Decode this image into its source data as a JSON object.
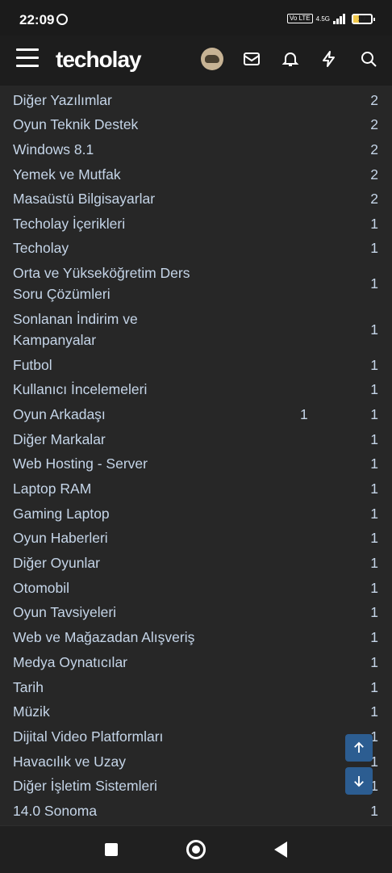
{
  "status": {
    "time": "22:09",
    "volte": "Vo LTE",
    "network": "4.5G",
    "battery": "17"
  },
  "header": {
    "logo": "techolay",
    "menu_icon": "hamburger-menu-icon",
    "avatar_icon": "avatar",
    "icons": [
      "mail-icon",
      "bell-icon",
      "lightning-icon",
      "search-icon"
    ]
  },
  "rows": [
    {
      "name": "Diğer Yazılımlar",
      "count": "2"
    },
    {
      "name": "Oyun Teknik Destek",
      "count": "2"
    },
    {
      "name": "Windows 8.1",
      "count": "2"
    },
    {
      "name": "Yemek ve Mutfak",
      "count": "2"
    },
    {
      "name": "Masaüstü Bilgisayarlar",
      "count": "2"
    },
    {
      "name": "Techolay İçerikleri",
      "count": "1"
    },
    {
      "name": "Techolay",
      "count": "1"
    },
    {
      "name": "Orta ve Yükseköğretim Ders",
      "name2": "Soru Çözümleri",
      "count": "1"
    },
    {
      "name": "Sonlanan İndirim ve",
      "name2": "Kampanyalar",
      "count": "1"
    },
    {
      "name": "Futbol",
      "count": "1"
    },
    {
      "name": "Kullanıcı İncelemeleri",
      "count": "1"
    },
    {
      "name": "Oyun Arkadaşı",
      "mid": "1",
      "count": "1"
    },
    {
      "name": "Diğer Markalar",
      "count": "1"
    },
    {
      "name": "Web Hosting - Server",
      "count": "1"
    },
    {
      "name": "Laptop RAM",
      "count": "1"
    },
    {
      "name": "Gaming Laptop",
      "count": "1"
    },
    {
      "name": "Oyun Haberleri",
      "count": "1"
    },
    {
      "name": "Diğer Oyunlar",
      "count": "1"
    },
    {
      "name": "Otomobil",
      "count": "1"
    },
    {
      "name": "Oyun Tavsiyeleri",
      "count": "1"
    },
    {
      "name": "Web ve Mağazadan Alışveriş",
      "count": "1"
    },
    {
      "name": "Medya Oynatıcılar",
      "count": "1"
    },
    {
      "name": "Tarih",
      "count": "1"
    },
    {
      "name": "Müzik",
      "count": "1"
    },
    {
      "name": "Dijital Video Platformları",
      "count": "1"
    },
    {
      "name": "Havacılık ve Uzay",
      "count": "1"
    },
    {
      "name": "Diğer İşletim Sistemleri",
      "count": "1"
    },
    {
      "name": "14.0 Sonoma",
      "count": "1"
    }
  ],
  "fabs": {
    "up_icon": "arrow-up-icon",
    "down_icon": "arrow-down-icon"
  },
  "colors": {
    "background": "#272727",
    "header": "#1d1d1d",
    "text": "#c5d5e8",
    "fab": "#2c5d91"
  }
}
